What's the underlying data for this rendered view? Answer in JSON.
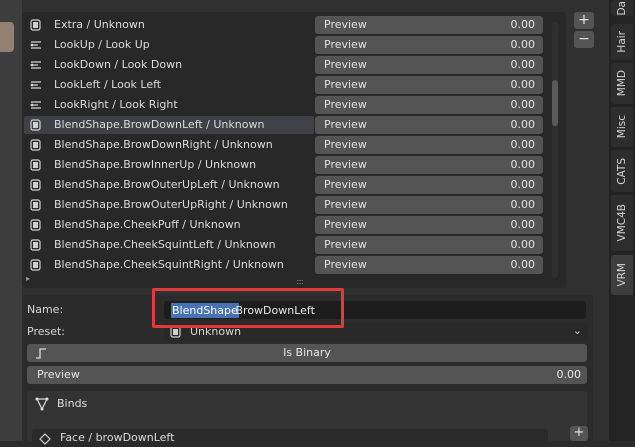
{
  "shape_list": {
    "preview_label": "Preview",
    "items": [
      {
        "label": "Extra / Unknown",
        "icon": "shapekey-icon",
        "preview_value": "0.00"
      },
      {
        "label": "LookUp / Look Up",
        "icon": "lines-icon",
        "preview_value": "0.00"
      },
      {
        "label": "LookDown / Look Down",
        "icon": "lines-icon",
        "preview_value": "0.00"
      },
      {
        "label": "LookLeft / Look Left",
        "icon": "lines-icon",
        "preview_value": "0.00"
      },
      {
        "label": "LookRight / Look Right",
        "icon": "lines-icon",
        "preview_value": "0.00"
      },
      {
        "label": "BlendShape.BrowDownLeft / Unknown",
        "icon": "shapekey-icon",
        "preview_value": "0.00"
      },
      {
        "label": "BlendShape.BrowDownRight / Unknown",
        "icon": "shapekey-icon",
        "preview_value": "0.00"
      },
      {
        "label": "BlendShape.BrowInnerUp / Unknown",
        "icon": "shapekey-icon",
        "preview_value": "0.00"
      },
      {
        "label": "BlendShape.BrowOuterUpLeft / Unknown",
        "icon": "shapekey-icon",
        "preview_value": "0.00"
      },
      {
        "label": "BlendShape.BrowOuterUpRight / Unknown",
        "icon": "shapekey-icon",
        "preview_value": "0.00"
      },
      {
        "label": "BlendShape.CheekPuff / Unknown",
        "icon": "shapekey-icon",
        "preview_value": "0.00"
      },
      {
        "label": "BlendShape.CheekSquintLeft / Unknown",
        "icon": "shapekey-icon",
        "preview_value": "0.00"
      },
      {
        "label": "BlendShape.CheekSquintRight / Unknown",
        "icon": "shapekey-icon",
        "preview_value": "0.00"
      }
    ],
    "selected_index": 5,
    "add_button": "+",
    "remove_button": "−",
    "grip": "::::",
    "expand_arrow": "▸"
  },
  "tabs": [
    "Da",
    "Hair",
    "MMD",
    "Misc",
    "CATS",
    "VMC4B",
    "VRM"
  ],
  "active_tab": "VRM",
  "properties": {
    "name_label": "Name:",
    "name_value_selected": "BlendShape",
    "name_value_rest": ".BrowDownLeft",
    "preset_label": "Preset:",
    "preset_value": "Unknown",
    "binary_label": "Is Binary",
    "preview_label": "Preview",
    "preview_value": "0.00",
    "binds_label": "Binds",
    "bind_item": "Face / browDownLeft",
    "add_bind": "+"
  },
  "colors": {
    "accent_selection": "#4772b3",
    "annotation_red": "#e23b3b"
  }
}
